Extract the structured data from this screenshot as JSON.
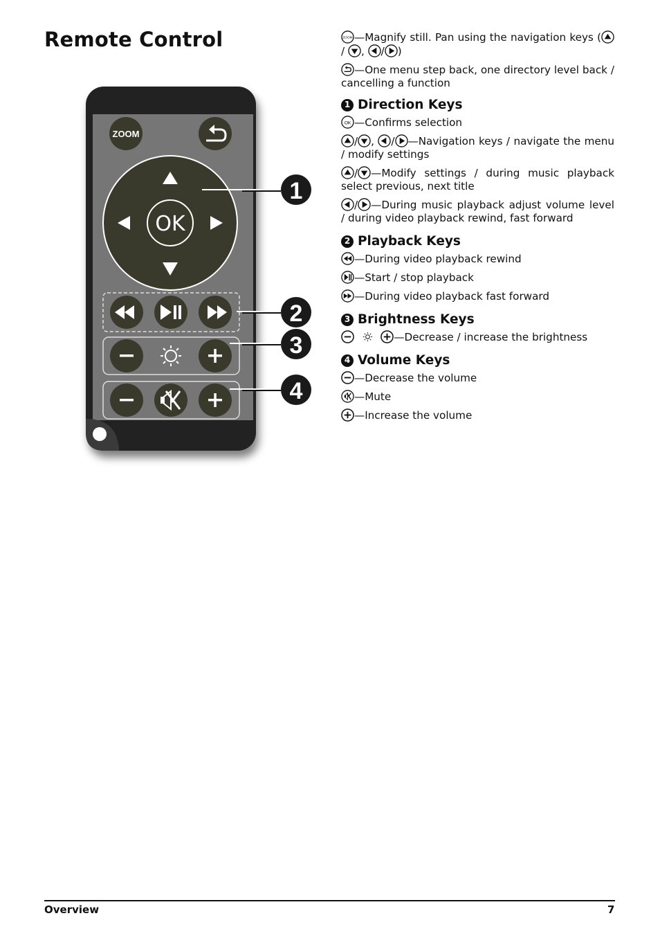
{
  "page": {
    "title": "Remote Control",
    "footer_section": "Overview",
    "page_number": "7"
  },
  "remote": {
    "zoom_label": "ZOOM",
    "ok_label": "OK",
    "callouts": [
      "1",
      "2",
      "3",
      "4"
    ],
    "colors": {
      "body": "#222222",
      "panel": "#767676",
      "button": "#393a2b",
      "accent_line": "#ffffff"
    }
  },
  "intro": [
    {
      "icons": [
        "zoom-icon"
      ],
      "text": "—Magnify still. Pan using the navigation keys (",
      "tail_icons": [
        "up-icon",
        "down-icon",
        "left-icon",
        "right-icon"
      ],
      "tail_text": ")"
    },
    {
      "icons": [
        "back-icon"
      ],
      "text": "—One menu step back, one directory level back / cancelling a function"
    }
  ],
  "sections": [
    {
      "number": "1",
      "heading": "Direction Keys",
      "items": [
        {
          "text": "—Confirms selection"
        },
        {
          "text": "—Navigation keys / navigate the menu / modify settings"
        },
        {
          "text": "—Modify settings / during music playback select previous, next title"
        },
        {
          "text": "—During music playback adjust volume level / during video playback rewind, fast forward"
        }
      ]
    },
    {
      "number": "2",
      "heading": "Playback Keys",
      "items": [
        {
          "text": "—During video playback rewind"
        },
        {
          "text": "—Start / stop playback"
        },
        {
          "text": "—During video playback fast forward"
        }
      ]
    },
    {
      "number": "3",
      "heading": "Brightness Keys",
      "items": [
        {
          "text": "—Decrease / increase the brightness"
        }
      ]
    },
    {
      "number": "4",
      "heading": "Volume Keys",
      "items": [
        {
          "text": "—Decrease the volume"
        },
        {
          "text": "—Mute"
        },
        {
          "text": "—Increase the volume"
        }
      ]
    }
  ]
}
